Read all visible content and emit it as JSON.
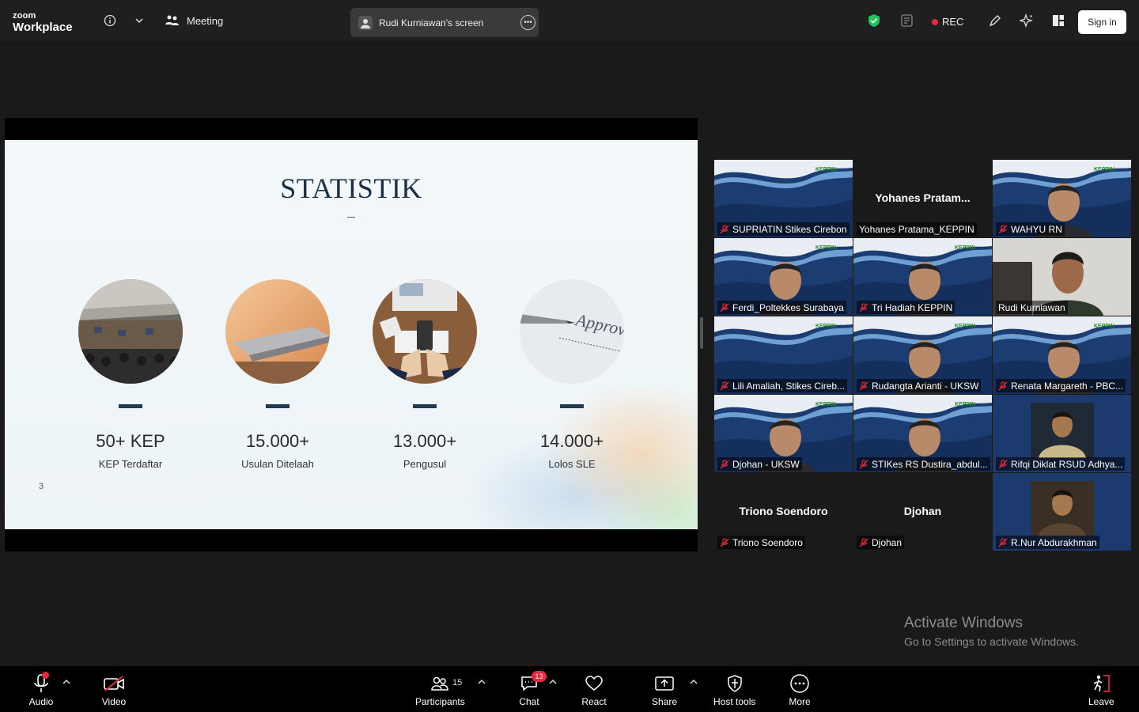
{
  "topbar": {
    "logo_top": "zoom",
    "logo_bottom": "Workplace",
    "meeting_label": "Meeting",
    "screen_share_label": "Rudi Kurniawan's screen",
    "rec_label": "REC",
    "signin_label": "Sign in",
    "colors": {
      "security": "#22c35e",
      "rec": "#e8293b"
    }
  },
  "slide": {
    "title": "STATISTIK",
    "page_number": "3",
    "stats": [
      {
        "value": "50+ KEP",
        "caption": "KEP Terdaftar",
        "image": "conference-hall"
      },
      {
        "value": "15.000+",
        "caption": "Usulan Ditelaah",
        "image": "laptop"
      },
      {
        "value": "13.000+",
        "caption": "Pengusul",
        "image": "desk-keyboard"
      },
      {
        "value": "14.000+",
        "caption": "Lolos SLE",
        "image": "approved-pen",
        "image_text": "Approv"
      }
    ]
  },
  "gallery": [
    {
      "name": "SUPRIATIN Stikes Cirebon",
      "muted": true
    },
    {
      "name": "Yohanes Pratama_KEPPIN",
      "display_name": "Yohanes  Pratam...",
      "muted": false
    },
    {
      "name": "WAHYU RN",
      "muted": true
    },
    {
      "name": "Ferdi_Poltekkes Surabaya",
      "muted": true
    },
    {
      "name": "Tri Hadiah KEPPIN",
      "muted": true
    },
    {
      "name": "Rudi Kurniawan",
      "muted": false,
      "active_speaker": true
    },
    {
      "name": "Lili Amaliah, Stikes Cireb...",
      "muted": true
    },
    {
      "name": "Rudangta Arianti - UKSW",
      "muted": true
    },
    {
      "name": "Renata Margareth - PBC...",
      "muted": true
    },
    {
      "name": "Djohan - UKSW",
      "muted": true
    },
    {
      "name": "STIKes RS Dustira_abdul...",
      "muted": true
    },
    {
      "name": "Rifqi Diklat RSUD Adhya...",
      "muted": true
    },
    {
      "name": "Triono Soendoro",
      "display_name": "Triono Soendoro",
      "muted": true
    },
    {
      "name": "Djohan",
      "display_name": "Djohan",
      "muted": true
    },
    {
      "name": "R.Nur Abdurakhman",
      "muted": true
    }
  ],
  "watermark": {
    "line1": "Activate Windows",
    "line2": "Go to Settings to activate Windows."
  },
  "bottombar": {
    "audio": "Audio",
    "video": "Video",
    "participants": "Participants",
    "participants_count": "15",
    "chat": "Chat",
    "chat_badge": "13",
    "react": "React",
    "share": "Share",
    "host_tools": "Host tools",
    "more": "More",
    "leave": "Leave"
  }
}
